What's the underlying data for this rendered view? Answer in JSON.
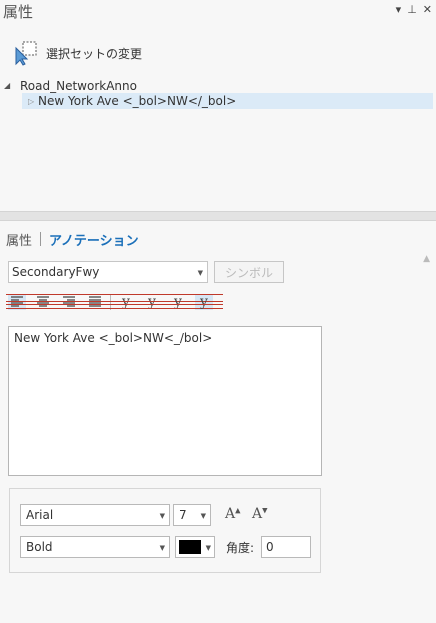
{
  "pane": {
    "title": "属性",
    "controls": {
      "menu": "▾",
      "pin": "⊥",
      "close": "✕"
    }
  },
  "selection": {
    "change_label": "選択セットの変更"
  },
  "tree": {
    "root_label": "Road_NetworkAnno",
    "root_toggle": "◢",
    "child_label": "New York Ave <_bol>NW</_bol>",
    "child_toggle": "▷"
  },
  "tabs": [
    {
      "label": "属性",
      "active": false
    },
    {
      "label": "アノテーション",
      "active": true
    }
  ],
  "annotation": {
    "class_value": "SecondaryFwy",
    "symbol_label": "シンボル",
    "text_value": "New York Ave <_bol>NW<_/bol>",
    "format_icons": [
      "align-left-icon",
      "align-center-icon",
      "align-right-icon",
      "justify-icon",
      "baseline-y-icon",
      "strike-y-icon",
      "underline-y-icon",
      "highlight-y-icon"
    ],
    "format_glyphs": {
      "y": "y"
    }
  },
  "font": {
    "family": "Arial",
    "size": "7",
    "grow_label": "A",
    "shrink_label": "A",
    "style": "Bold",
    "color": "#000000",
    "angle_label": "角度:",
    "angle_value": "0"
  },
  "colors": {
    "accent": "#1a6fb9",
    "selection_bg": "#dbeaf7"
  }
}
